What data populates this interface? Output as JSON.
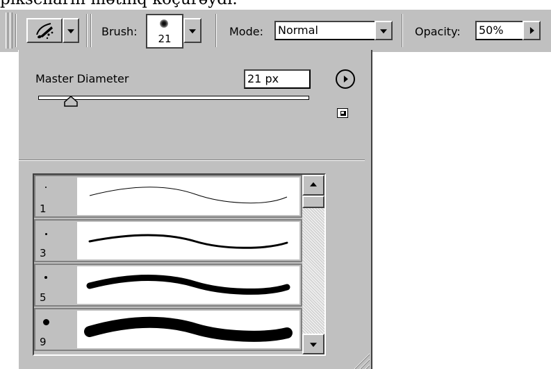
{
  "caption": {
    "text": "pikselların mətinq köçürəydı."
  },
  "options_bar": {
    "brush_label": "Brush:",
    "brush_size": "21",
    "mode_label": "Mode:",
    "mode_value": "Normal",
    "opacity_label": "Opacity:",
    "opacity_value": "50%"
  },
  "brush_panel": {
    "master_diameter_label": "Master Diameter",
    "diameter_value": "21 px",
    "slider_fraction": 0.12,
    "brushes": [
      {
        "size": "1"
      },
      {
        "size": "3"
      },
      {
        "size": "5"
      },
      {
        "size": "9"
      }
    ]
  },
  "icons": {
    "tool": "history-brush-icon",
    "menu": "flyout-arrow-icon",
    "new_preset": "new-preset-icon",
    "resize": "resize-grip-icon"
  }
}
